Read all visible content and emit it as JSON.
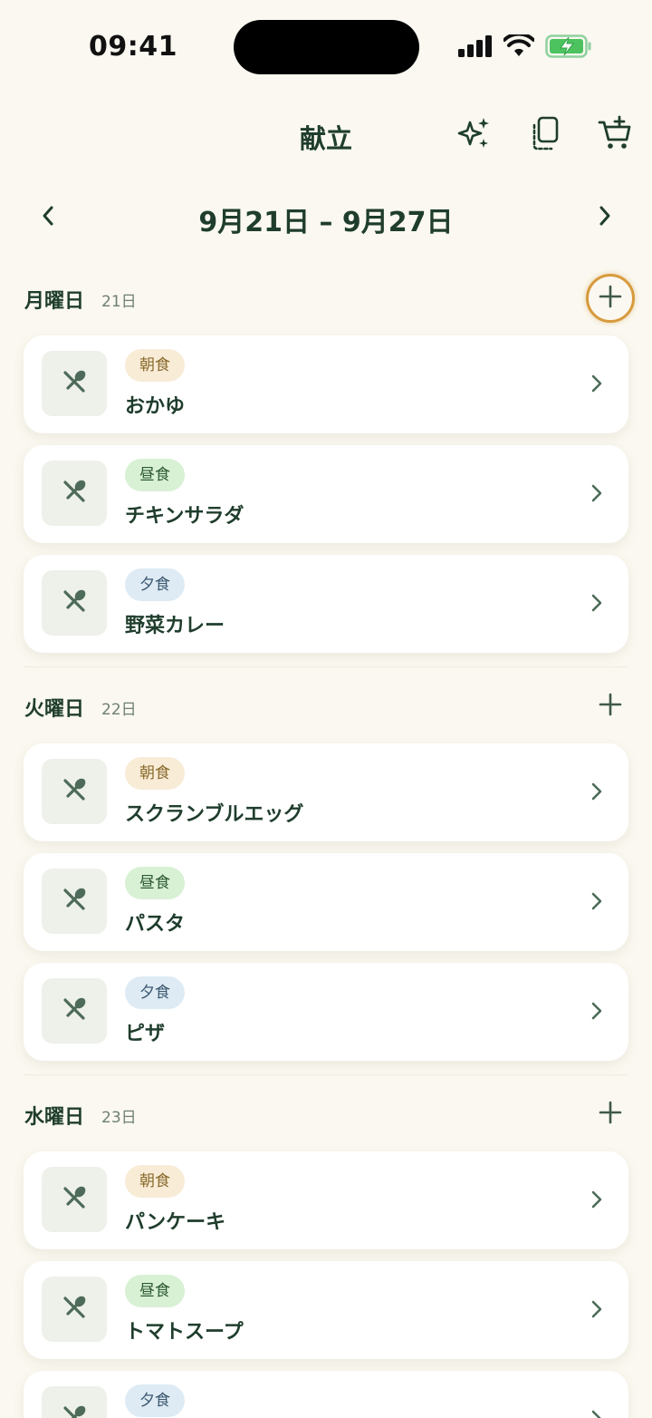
{
  "status_bar": {
    "time": "09:41"
  },
  "header": {
    "title": "献立",
    "icons": [
      "sparkles-icon",
      "copy-icon",
      "cart-add-icon"
    ]
  },
  "week_nav": {
    "label": "9月21日 – 9月27日",
    "prev_icon": "chevron-left-icon",
    "next_icon": "chevron-right-icon"
  },
  "colors": {
    "accent": "#1f3d2c",
    "highlight_ring": "#d79a3c",
    "background": "#faf8f0",
    "breakfast_badge": "#f8ecd7",
    "lunch_badge": "#d8f1d4",
    "dinner_badge": "#deebf4"
  },
  "days": [
    {
      "name": "月曜日",
      "date": "21日",
      "meals": [
        {
          "badge": "朝食",
          "name": "おかゆ"
        },
        {
          "badge": "昼食",
          "name": "チキンサラダ"
        },
        {
          "badge": "夕食",
          "name": "野菜カレー"
        }
      ]
    },
    {
      "name": "火曜日",
      "date": "22日",
      "meals": [
        {
          "badge": "朝食",
          "name": "スクランブルエッグ"
        },
        {
          "badge": "昼食",
          "name": "パスタ"
        },
        {
          "badge": "夕食",
          "name": "ピザ"
        }
      ]
    },
    {
      "name": "水曜日",
      "date": "23日",
      "meals": [
        {
          "badge": "朝食",
          "name": "パンケーキ"
        },
        {
          "badge": "昼食",
          "name": "トマトスープ"
        },
        {
          "badge": "夕食",
          "name": ""
        }
      ]
    }
  ]
}
